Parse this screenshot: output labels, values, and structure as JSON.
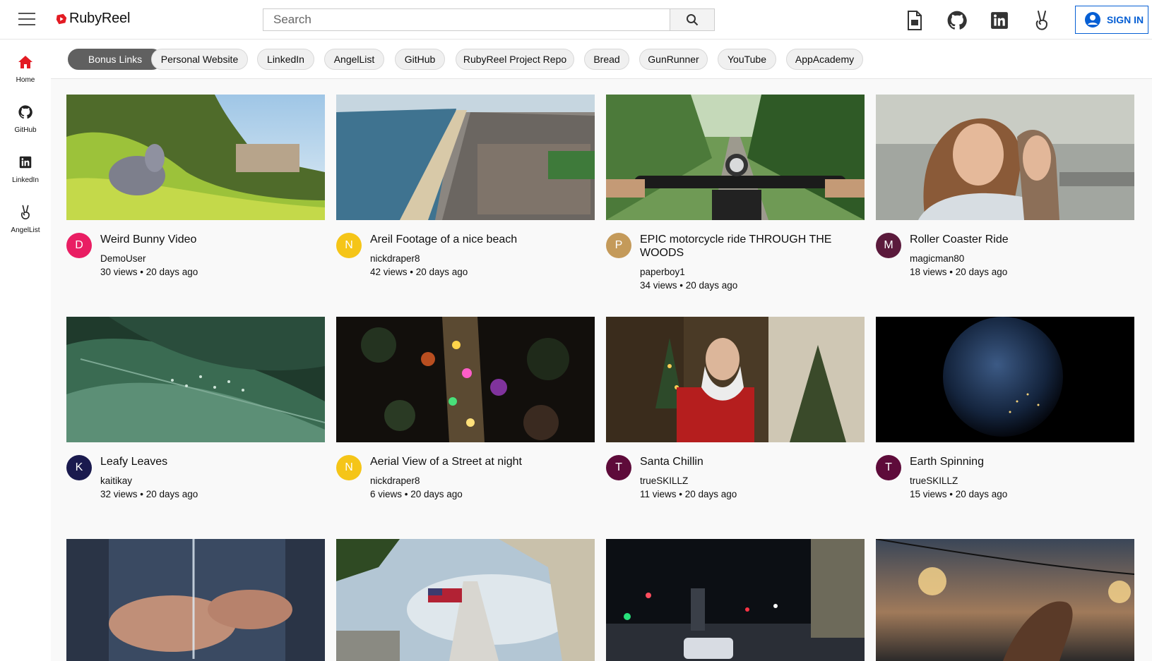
{
  "app": {
    "name": "RubyReel",
    "brand_color": "#e31b23"
  },
  "search": {
    "placeholder": "Search"
  },
  "header_icons": [
    "resume-icon",
    "github-icon",
    "linkedin-icon",
    "angellist-icon"
  ],
  "signin": {
    "label": "SIGN IN",
    "color": "#065fd4"
  },
  "sidebar": {
    "items": [
      {
        "label": "Home",
        "icon": "home-icon"
      },
      {
        "label": "GitHub",
        "icon": "github-icon"
      },
      {
        "label": "LinkedIn",
        "icon": "linkedin-icon"
      },
      {
        "label": "AngelList",
        "icon": "angellist-icon"
      }
    ]
  },
  "chips": [
    "Bonus Links",
    "Personal Website",
    "LinkedIn",
    "AngelList",
    "GitHub",
    "RubyReel Project Repo",
    "Bread",
    "GunRunner",
    "YouTube",
    "AppAcademy"
  ],
  "videos": [
    {
      "title": "Weird Bunny Video",
      "channel": "DemoUser",
      "stats": "30 views • 20 days ago",
      "avatar_letter": "D",
      "avatar_color": "#e91e63"
    },
    {
      "title": "Areil Footage of a nice beach",
      "channel": "nickdraper8",
      "stats": "42 views • 20 days ago",
      "avatar_letter": "N",
      "avatar_color": "#f5c518"
    },
    {
      "title": "EPIC motorcycle ride THROUGH THE WOODS",
      "channel": "paperboy1",
      "stats": "34 views • 20 days ago",
      "avatar_letter": "P",
      "avatar_color": "#c49a5a"
    },
    {
      "title": "Roller Coaster Ride",
      "channel": "magicman80",
      "stats": "18 views • 20 days ago",
      "avatar_letter": "M",
      "avatar_color": "#5b1a3c"
    },
    {
      "title": "Leafy Leaves",
      "channel": "kaitikay",
      "stats": "32 views • 20 days ago",
      "avatar_letter": "K",
      "avatar_color": "#1a1a4e"
    },
    {
      "title": "Aerial View of a Street at night",
      "channel": "nickdraper8",
      "stats": "6 views • 20 days ago",
      "avatar_letter": "N",
      "avatar_color": "#f5c518"
    },
    {
      "title": "Santa Chillin",
      "channel": "trueSKILLZ",
      "stats": "11 views • 20 days ago",
      "avatar_letter": "T",
      "avatar_color": "#5e0b3a"
    },
    {
      "title": "Earth Spinning",
      "channel": "trueSKILLZ",
      "stats": "15 views • 20 days ago",
      "avatar_letter": "T",
      "avatar_color": "#5e0b3a"
    },
    {
      "title": "",
      "channel": "",
      "stats": "",
      "avatar_letter": "",
      "avatar_color": ""
    },
    {
      "title": "",
      "channel": "",
      "stats": "",
      "avatar_letter": "",
      "avatar_color": ""
    },
    {
      "title": "",
      "channel": "",
      "stats": "",
      "avatar_letter": "",
      "avatar_color": ""
    },
    {
      "title": "",
      "channel": "",
      "stats": "",
      "avatar_letter": "",
      "avatar_color": ""
    }
  ]
}
